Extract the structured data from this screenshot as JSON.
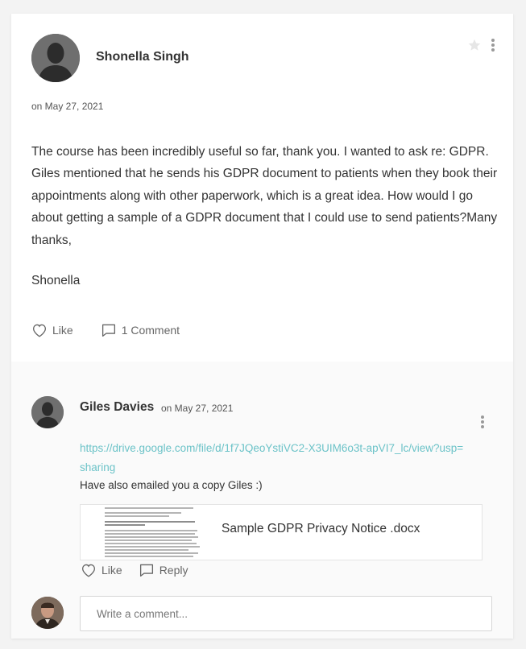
{
  "post": {
    "author": "Shonella Singh",
    "date": "on May 27, 2021",
    "body": "The course has been incredibly useful so far, thank you. I wanted to ask re: GDPR. Giles mentioned that he sends his GDPR document to patients when they book their appointments along with other paperwork, which is a great idea. How would I go about getting a sample of a GDPR document that I could use to send patients?Many thanks,",
    "signoff": "Shonella",
    "like_label": "Like",
    "comments_label": "1 Comment"
  },
  "comment": {
    "author": "Giles Davies",
    "date": "on May 27, 2021",
    "link": "https://drive.google.com/file/d/1f7JQeoYstiVC2-X3UIM6o3t-apVI7_lc/view?usp=sharing",
    "text": "Have also emailed you a copy Giles :)",
    "attachment_name": "Sample GDPR Privacy Notice .docx",
    "like_label": "Like",
    "reply_label": "Reply"
  },
  "composer": {
    "placeholder": "Write a comment..."
  },
  "colors": {
    "link": "#6cc3c8",
    "text": "#333333",
    "muted": "#666666"
  },
  "icons": {
    "favorite": "star-icon",
    "menu": "more-vertical-icon",
    "like": "heart-icon",
    "comment": "comment-icon",
    "reply": "reply-icon"
  }
}
